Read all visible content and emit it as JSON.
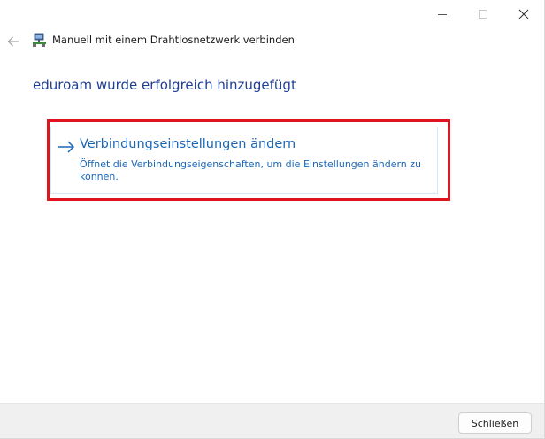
{
  "window": {
    "title": "Manuell mit einem Drahtlosnetzwerk verbinden",
    "caption_icons": [
      "minimize-icon",
      "maximize-icon",
      "close-icon"
    ],
    "back_icon": "arrow-left-icon",
    "title_icon": "network-icon"
  },
  "main": {
    "heading": "eduroam wurde erfolgreich hinzugefügt",
    "option": {
      "icon": "arrow-right-icon",
      "title": "Verbindungseinstellungen ändern",
      "description": "Öffnet die Verbindungseigenschaften, um die Einstellungen ändern zu können."
    }
  },
  "footer": {
    "close_label": "Schließen"
  },
  "colors": {
    "heading": "#1f3f93",
    "link": "#1a67b5",
    "highlight": "#e0141e",
    "footer_bg": "#f0f0f0"
  }
}
